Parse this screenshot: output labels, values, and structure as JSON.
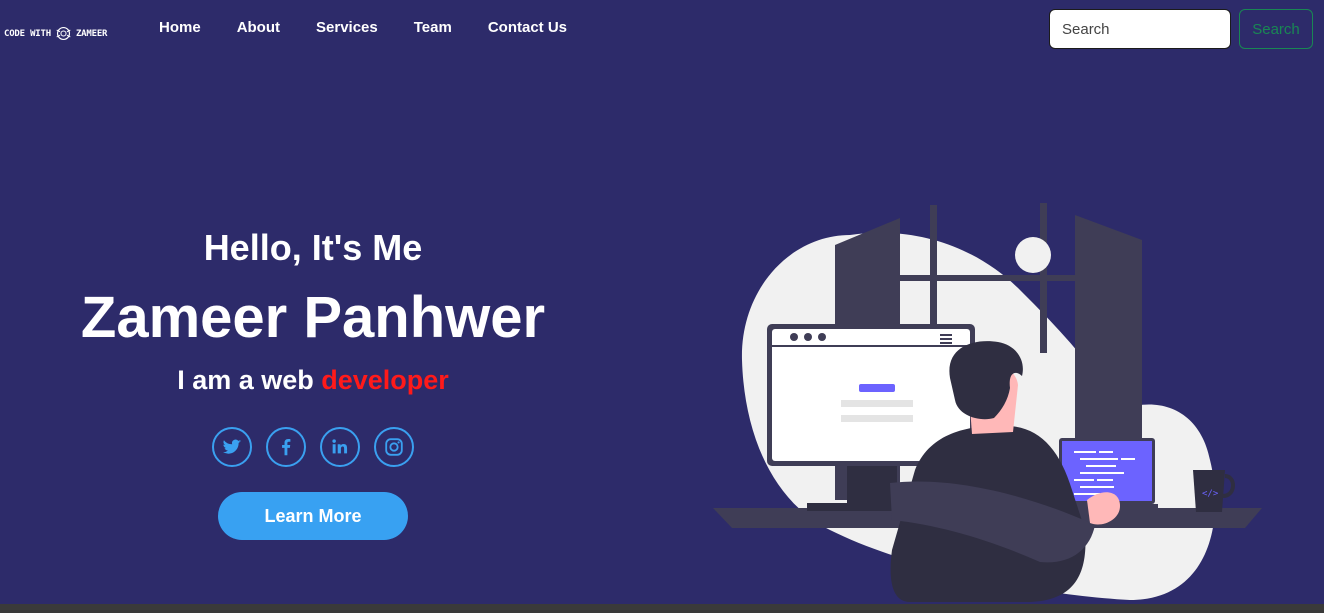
{
  "brand": {
    "text_left": "CODE WITH",
    "text_right": "ZAMEER"
  },
  "nav": {
    "links": [
      {
        "label": "Home"
      },
      {
        "label": "About"
      },
      {
        "label": "Services"
      },
      {
        "label": "Team"
      },
      {
        "label": "Contact Us"
      }
    ]
  },
  "search": {
    "placeholder": "Search",
    "button_label": "Search"
  },
  "hero": {
    "greeting": "Hello, It's Me",
    "name": "Zameer Panhwer",
    "role_prefix": "I am a web ",
    "role_highlight": "developer",
    "cta_label": "Learn More"
  },
  "social": [
    {
      "name": "twitter-icon"
    },
    {
      "name": "facebook-icon"
    },
    {
      "name": "linkedin-icon"
    },
    {
      "name": "instagram-icon"
    }
  ],
  "colors": {
    "background": "#2d2b6a",
    "accent_blue": "#38a1f2",
    "highlight_red": "#ff1a1a",
    "search_green": "#198754"
  }
}
